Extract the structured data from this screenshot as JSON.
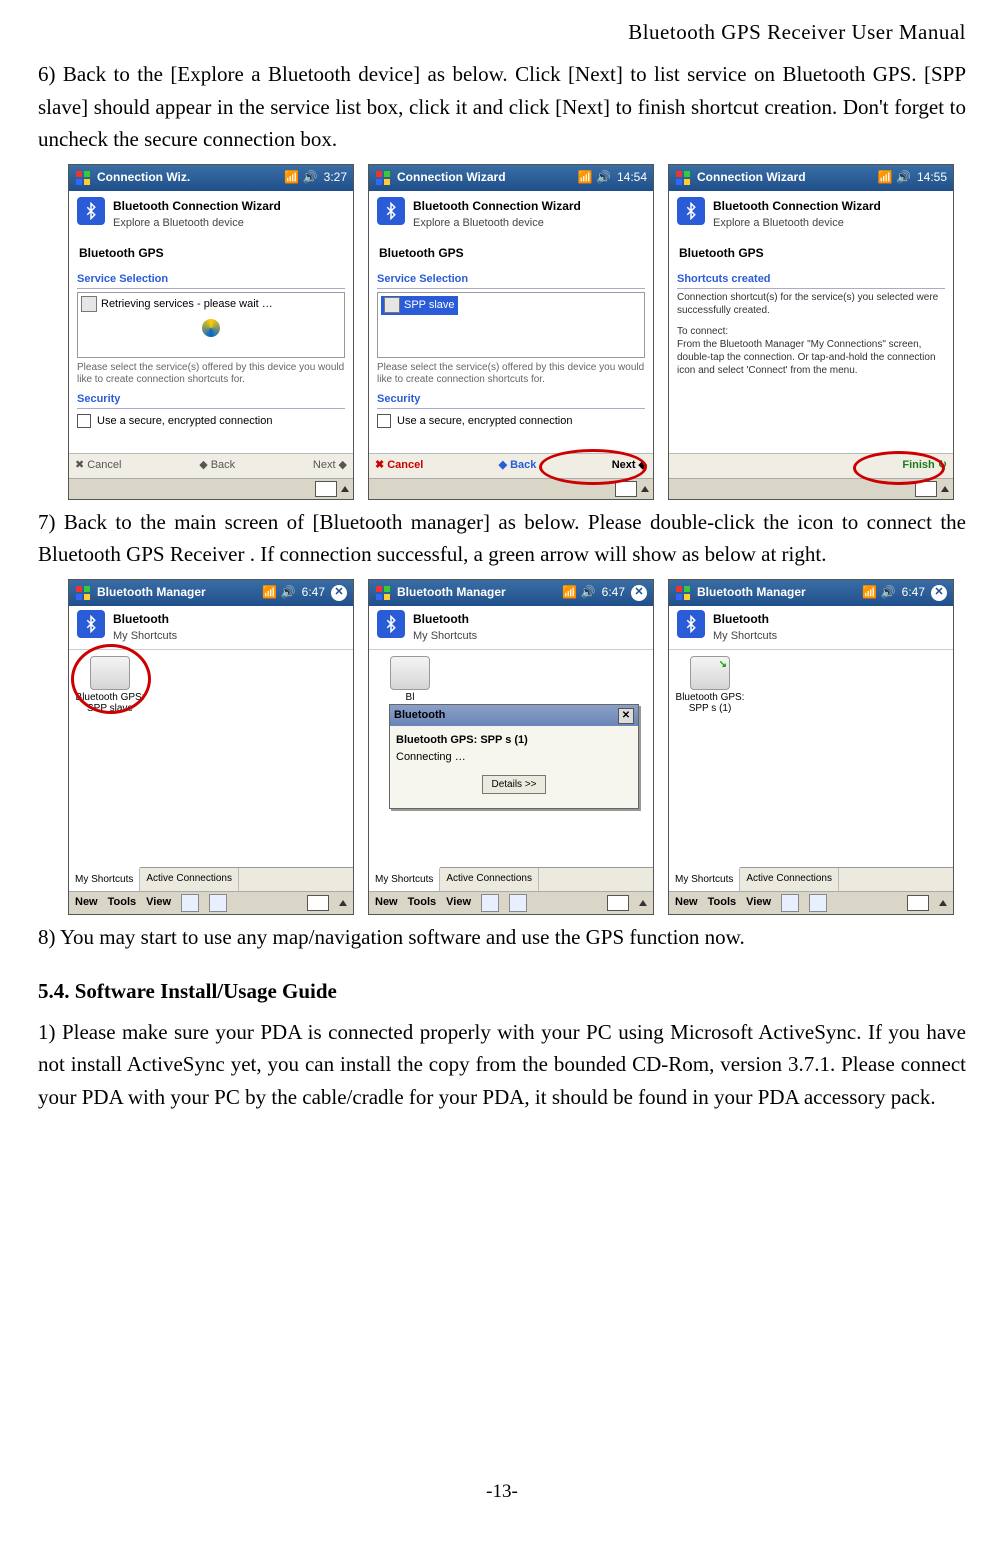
{
  "doc_header": "Bluetooth  GPS  Receiver  User  Manual",
  "page_number": "-13-",
  "paragraphs": {
    "p6": "6) Back to the [Explore a Bluetooth device] as below. Click [Next] to list service on Bluetooth GPS. [SPP slave] should appear in the service list box, click it and click [Next] to finish shortcut creation. Don't forget to uncheck the secure connection box.",
    "p7": "7) Back to the main screen of [Bluetooth manager] as below. Please double-click the icon to connect the Bluetooth GPS Receiver . If connection successful, a green arrow will show as below at right.",
    "p8": "8) You may start to use any map/navigation software and use the GPS function now.",
    "sec54_title": "5.4. Software Install/Usage Guide",
    "sec54_1": "1) Please make sure your PDA is connected properly with your PC using Microsoft ActiveSync. If you have not install ActiveSync yet, you can install the copy from the bounded CD-Rom, version 3.7.1. Please connect your PDA with your PC by the cable/cradle for your PDA, it should be found in your PDA accessory pack."
  },
  "wiz": {
    "title": "Bluetooth Connection Wizard",
    "subtitle": "Explore a Bluetooth device",
    "device": "Bluetooth GPS",
    "service_selection": "Service Selection",
    "security": "Security",
    "secure_label": "Use a secure, encrypted connection",
    "hint": "Please select the service(s) offered by this device you would like to create connection shortcuts for.",
    "cancel": "Cancel",
    "back": "Back",
    "next": "Next",
    "finish": "Finish",
    "shot1": {
      "bar_title": "Connection Wiz.",
      "bar_time": "3:27",
      "retrieving": "Retrieving services - please wait …"
    },
    "shot2": {
      "bar_title": "Connection Wizard",
      "bar_time": "14:54",
      "spp": "SPP slave"
    },
    "shot3": {
      "bar_title": "Connection Wizard",
      "bar_time": "14:55",
      "grp_title": "Shortcuts created",
      "body1": "Connection shortcut(s) for the service(s) you selected were successfully created.",
      "body2_label": "To connect:",
      "body2": "From the Bluetooth Manager \"My Connections\" screen, double-tap the connection. Or tap-and-hold the connection icon and select 'Connect' from the menu."
    }
  },
  "bm": {
    "bar_title": "Bluetooth Manager",
    "bar_time": "6:47",
    "header": "Bluetooth",
    "sub": "My Shortcuts",
    "tab1": "My Shortcuts",
    "tab2": "Active Connections",
    "menu_new": "New",
    "menu_tools": "Tools",
    "menu_view": "View",
    "shot1_label": "Bluetooth GPS: SPP slave",
    "shot3_label": "Bluetooth GPS: SPP s (1)",
    "dlg": {
      "title": "Bluetooth",
      "line1": "Bluetooth GPS: SPP s (1)",
      "line2": "Connecting …",
      "btn": "Details >>"
    }
  }
}
